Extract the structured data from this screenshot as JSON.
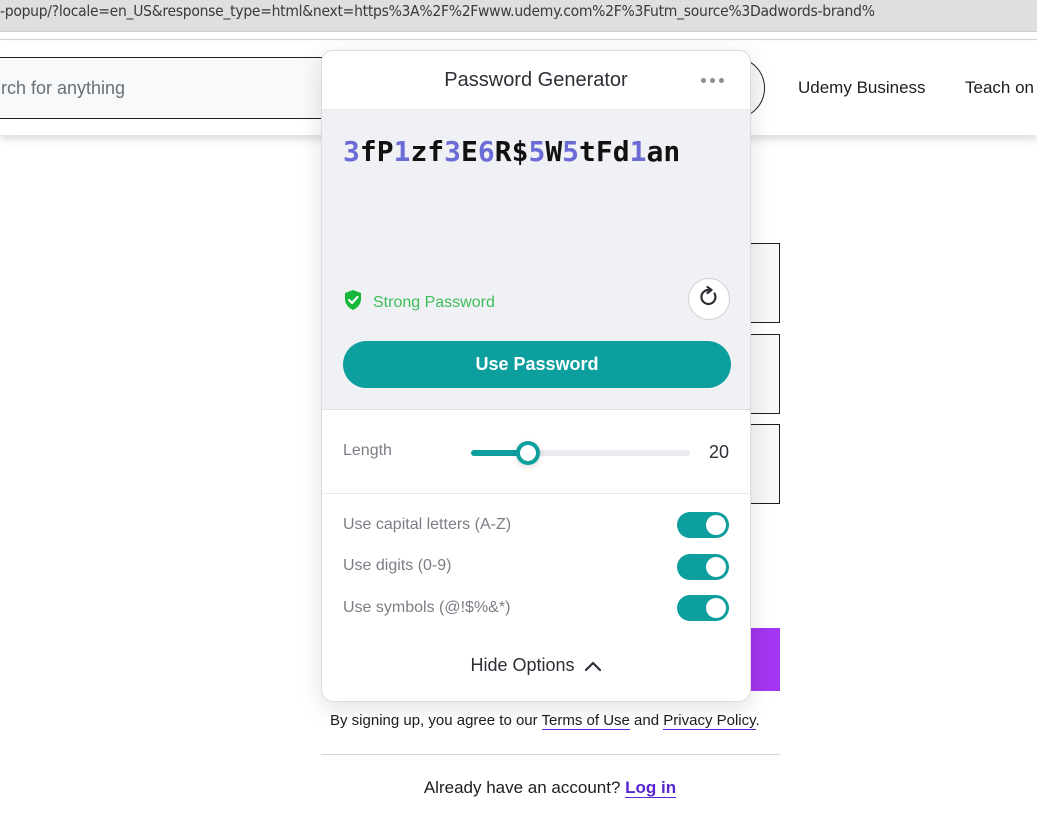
{
  "browser": {
    "url": "-popup/?locale=en_US&response_type=html&next=https%3A%2F%2Fwww.udemy.com%2F%3Futm_source%3Dadwords-brand%"
  },
  "site_header": {
    "search_placeholder": "rch for anything",
    "nav": [
      "Udemy Business",
      "Teach on"
    ]
  },
  "signup": {
    "terms_prefix": "By signing up, you agree to our ",
    "terms_link": "Terms of Use",
    "terms_and": " and ",
    "privacy_link": "Privacy Policy",
    "terms_suffix": ".",
    "login_prompt": "Already have an account? ",
    "login_link": "Log in",
    "signup_button_color": "#a435f0"
  },
  "popup": {
    "title": "Password Generator",
    "more_icon": "more-horizontal-icon",
    "password": "3fP1zf3E6R$5W5tFd1an",
    "strength_label": "Strong Password",
    "strength_color": "#3ebd5a",
    "refresh_icon": "refresh-icon",
    "use_button": "Use Password",
    "accent_color": "#0d9e9e",
    "digit_color": "#6b6bd6",
    "length": {
      "label": "Length",
      "value": "20",
      "slider_fraction": 0.26
    },
    "options": [
      {
        "label": "Use capital letters (A-Z)",
        "enabled": true
      },
      {
        "label": "Use digits (0-9)",
        "enabled": true
      },
      {
        "label": "Use symbols (@!$%&*)",
        "enabled": true
      }
    ],
    "hide_options": "Hide Options"
  }
}
